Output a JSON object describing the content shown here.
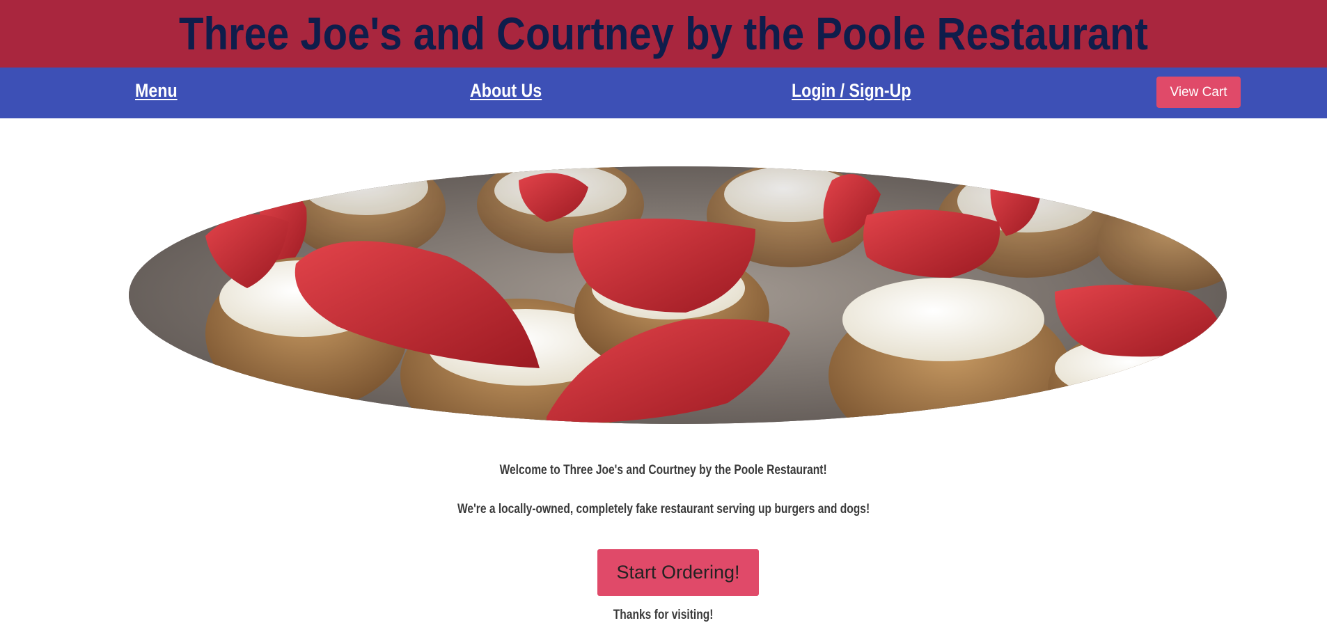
{
  "header": {
    "title": "Three Joe's and Courtney by the Poole Restaurant"
  },
  "nav": {
    "menu": "Menu",
    "about": "About Us",
    "login": "Login / Sign-Up",
    "view_cart": "View Cart"
  },
  "hero": {
    "image_name": "strawberry-cream-cookie-cups-photo"
  },
  "main": {
    "welcome": "Welcome to Three Joe's and Courtney by the Poole Restaurant!",
    "tagline": "We're a locally-owned, completely fake restaurant serving up burgers and dogs!",
    "start_button": "Start Ordering!",
    "thanks": "Thanks for visiting!"
  },
  "colors": {
    "header_bg": "#a9263e",
    "title_color": "#0f1d4b",
    "nav_bg": "#3d50b6",
    "button_bg": "#e04a69"
  }
}
